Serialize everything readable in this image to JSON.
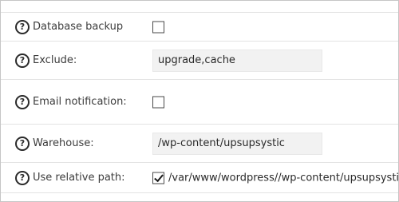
{
  "settings": {
    "rows": [
      {
        "label": "Database backup",
        "type": "checkbox",
        "checked": false
      },
      {
        "label": "Exclude:",
        "type": "text",
        "value": "upgrade,cache"
      },
      {
        "label": "Email notification:",
        "type": "checkbox",
        "checked": false
      },
      {
        "label": "Warehouse:",
        "type": "text",
        "value": "/wp-content/upsupsystic"
      },
      {
        "label": "Use relative path:",
        "type": "checkbox",
        "checked": true,
        "path": "/var/www/wordpress//wp-content/upsupsystic"
      }
    ],
    "help_icon_glyph": "?"
  }
}
